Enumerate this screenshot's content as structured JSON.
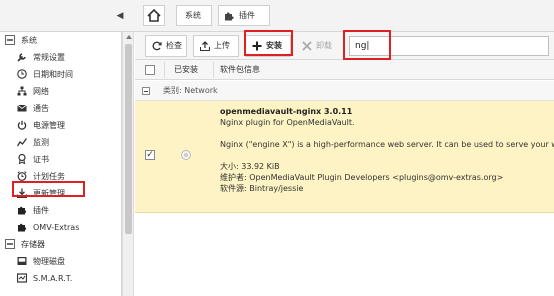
{
  "topbar": {
    "collapse_icon": "caret-left-icon",
    "breadcrumbs": [
      {
        "label": ""
      },
      {
        "label": "系统"
      },
      {
        "label": "插件"
      }
    ]
  },
  "sidebar": {
    "items": [
      {
        "label": "系统",
        "icon": "minus-square-icon",
        "group": true
      },
      {
        "label": "常规设置",
        "icon": "wrench-icon"
      },
      {
        "label": "日期和时间",
        "icon": "clock-icon"
      },
      {
        "label": "网络",
        "icon": "network-icon"
      },
      {
        "label": "通告",
        "icon": "envelope-icon"
      },
      {
        "label": "电源管理",
        "icon": "power-icon"
      },
      {
        "label": "监测",
        "icon": "chart-icon"
      },
      {
        "label": "证书",
        "icon": "certificate-icon"
      },
      {
        "label": "计划任务",
        "icon": "alarm-icon"
      },
      {
        "label": "更新管理",
        "icon": "download-icon"
      },
      {
        "label": "插件",
        "icon": "puzzle-icon"
      },
      {
        "label": "OMV-Extras",
        "icon": "puzzle-icon"
      },
      {
        "label": "存储器",
        "icon": "minus-square-icon",
        "group": true
      },
      {
        "label": "物理磁盘",
        "icon": "disk-icon"
      },
      {
        "label": "S.M.A.R.T.",
        "icon": "smart-icon"
      }
    ]
  },
  "toolbar": {
    "check_label": "检查",
    "upload_label": "上传",
    "install_label": "安装",
    "uninstall_label": "卸载",
    "search_value": "ng|"
  },
  "grid": {
    "headers": [
      "已安装",
      "软件包信息"
    ],
    "group_label": "类别: Network",
    "row": {
      "title": "openmediavault-nginx 3.0.11",
      "line1": "Nginx plugin for OpenMediaVault.",
      "line2": "Nginx (\"engine X\") is a high-performance web server. It can be used to serve your web",
      "size": "大小: 33.92 KiB",
      "maintainer": "维护者: OpenMediaVault Plugin Developers <plugins@omv-extras.org>",
      "repo": "软件源: Bintray/jessie"
    }
  },
  "colors": {
    "selected_row": "#fdf3c4",
    "annotation_red": "#e02020"
  }
}
